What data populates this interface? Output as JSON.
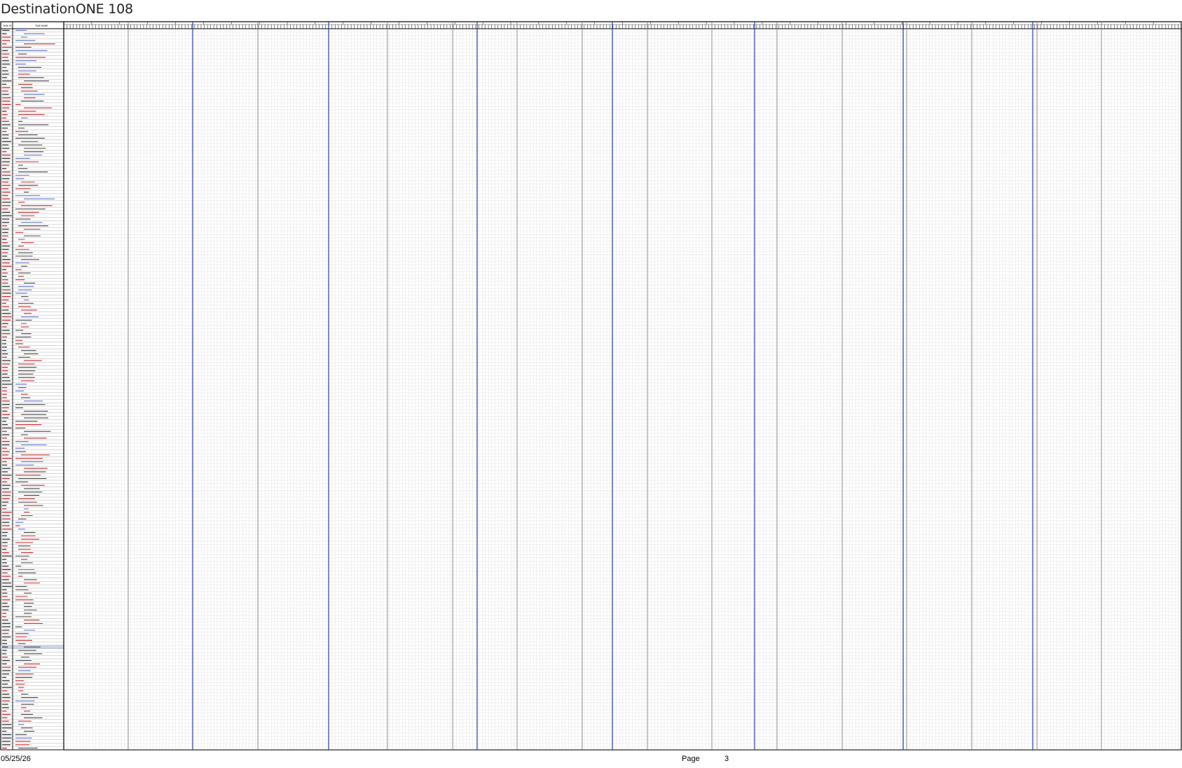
{
  "document": {
    "title": "DestinationONE 108",
    "footer": {
      "date": "05/25/26",
      "page_label": "Page",
      "page_number": "3"
    },
    "table": {
      "header_col1": "TASK ID",
      "header_col2": "TASK NAME",
      "row_count": 214,
      "timeline_columns": 350,
      "highlight_color": "#c8d4ec",
      "accent_color": "#1a2f9c",
      "red_id_color": "#c0282d",
      "red_text_color": "#c0282d",
      "blue_text_color": "#5a6ec8",
      "grid_color": "#9a9a9a"
    }
  }
}
